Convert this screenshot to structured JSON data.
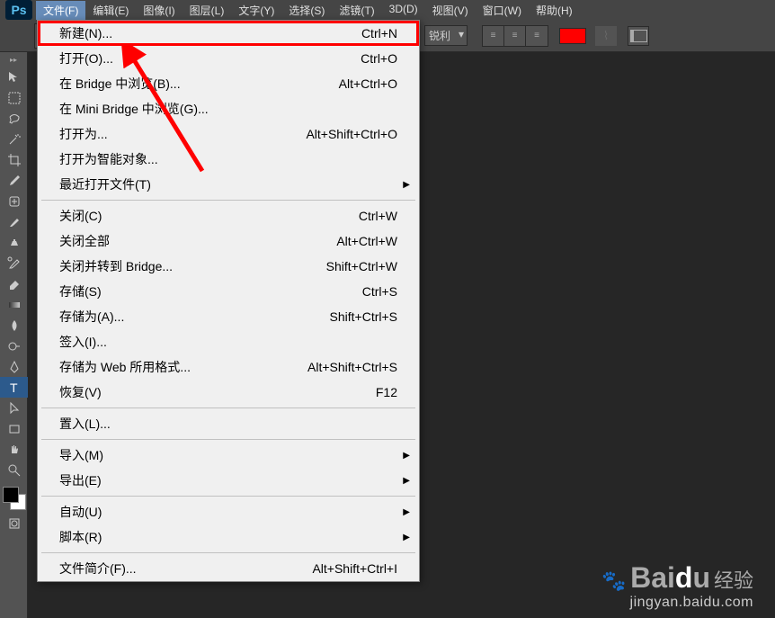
{
  "menubar": {
    "items": [
      "文件(F)",
      "编辑(E)",
      "图像(I)",
      "图层(L)",
      "文字(Y)",
      "选择(S)",
      "滤镜(T)",
      "3D(D)",
      "视图(V)",
      "窗口(W)",
      "帮助(H)"
    ]
  },
  "optionsbar": {
    "antialias": "锐利"
  },
  "dropdown": [
    {
      "label": "新建(N)...",
      "shortcut": "Ctrl+N",
      "highlight": true
    },
    {
      "label": "打开(O)...",
      "shortcut": "Ctrl+O"
    },
    {
      "label": "在 Bridge 中浏览(B)...",
      "shortcut": "Alt+Ctrl+O"
    },
    {
      "label": "在 Mini Bridge 中浏览(G)..."
    },
    {
      "label": "打开为...",
      "shortcut": "Alt+Shift+Ctrl+O"
    },
    {
      "label": "打开为智能对象..."
    },
    {
      "label": "最近打开文件(T)",
      "submenu": true
    },
    {
      "sep": true
    },
    {
      "label": "关闭(C)",
      "shortcut": "Ctrl+W"
    },
    {
      "label": "关闭全部",
      "shortcut": "Alt+Ctrl+W"
    },
    {
      "label": "关闭并转到 Bridge...",
      "shortcut": "Shift+Ctrl+W"
    },
    {
      "label": "存储(S)",
      "shortcut": "Ctrl+S"
    },
    {
      "label": "存储为(A)...",
      "shortcut": "Shift+Ctrl+S"
    },
    {
      "label": "签入(I)..."
    },
    {
      "label": "存储为 Web 所用格式...",
      "shortcut": "Alt+Shift+Ctrl+S"
    },
    {
      "label": "恢复(V)",
      "shortcut": "F12"
    },
    {
      "sep": true
    },
    {
      "label": "置入(L)..."
    },
    {
      "sep": true
    },
    {
      "label": "导入(M)",
      "submenu": true
    },
    {
      "label": "导出(E)",
      "submenu": true
    },
    {
      "sep": true
    },
    {
      "label": "自动(U)",
      "submenu": true
    },
    {
      "label": "脚本(R)",
      "submenu": true
    },
    {
      "sep": true
    },
    {
      "label": "文件简介(F)...",
      "shortcut": "Alt+Shift+Ctrl+I"
    }
  ],
  "watermark": {
    "brand_prefix": "Bai",
    "brand_d": "d",
    "brand_suffix": "u",
    "cn": "经验",
    "url": "jingyan.baidu.com"
  },
  "colors": {
    "swatch": "#ff0000"
  }
}
